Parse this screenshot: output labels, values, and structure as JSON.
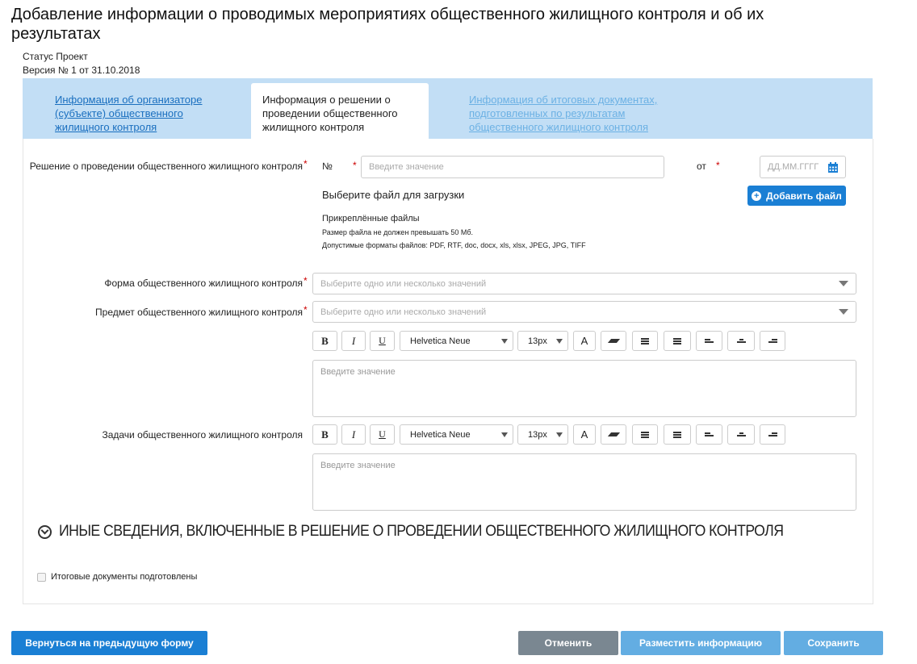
{
  "page_title": "Добавление информации о проводимых мероприятиях общественного жилищного контроля и об их результатах",
  "status": "Статус Проект",
  "version": "Версия № 1 от 31.10.2018",
  "tabs": [
    {
      "label": "Информация об организаторе (субъекте) общественного жилищного контроля"
    },
    {
      "label": "Информация о решении о проведении общественного жилищного контроля"
    },
    {
      "label": "Информация об итоговых документах, подготовленных по результатам общественного жилищного контроля"
    }
  ],
  "decision": {
    "label": "Решение о проведении общественного жилищного контроля",
    "number_label": "№",
    "number_placeholder": "Введите значение",
    "date_label": "от",
    "date_placeholder": "ДД.ММ.ГГГГ",
    "file_prompt": "Выберите файл для загрузки",
    "add_file": "Добавить файл",
    "attached": "Прикреплённые файлы",
    "size_note": "Размер файла не должен превышать 50 Мб.",
    "formats_note": "Допустимые форматы файлов: PDF, RTF, doc, docx, xls, xlsx, JPEG, JPG, TIFF"
  },
  "form_field": {
    "label": "Форма общественного жилищного контроля",
    "placeholder": "Выберите одно или несколько значений"
  },
  "subject_field": {
    "label": "Предмет общественного жилищного контроля",
    "placeholder": "Выберите одно или несколько значений"
  },
  "tasks_field": {
    "label": "Задачи общественного жилищного контроля"
  },
  "editor": {
    "bold": "B",
    "italic": "I",
    "underline": "U",
    "font": "Helvetica Neue",
    "size": "13px",
    "color": "A",
    "placeholder": "Введите значение"
  },
  "section_title": "ИНЫЕ СВЕДЕНИЯ, ВКЛЮЧЕННЫЕ В РЕШЕНИЕ О ПРОВЕДЕНИИ ОБЩЕСТВЕННОГО ЖИЛИЩНОГО КОНТРОЛЯ",
  "checkbox_label": "Итоговые документы подготовлены",
  "buttons": {
    "back": "Вернуться на предыдущую форму",
    "cancel": "Отменить",
    "publish": "Разместить информацию",
    "save": "Сохранить"
  }
}
